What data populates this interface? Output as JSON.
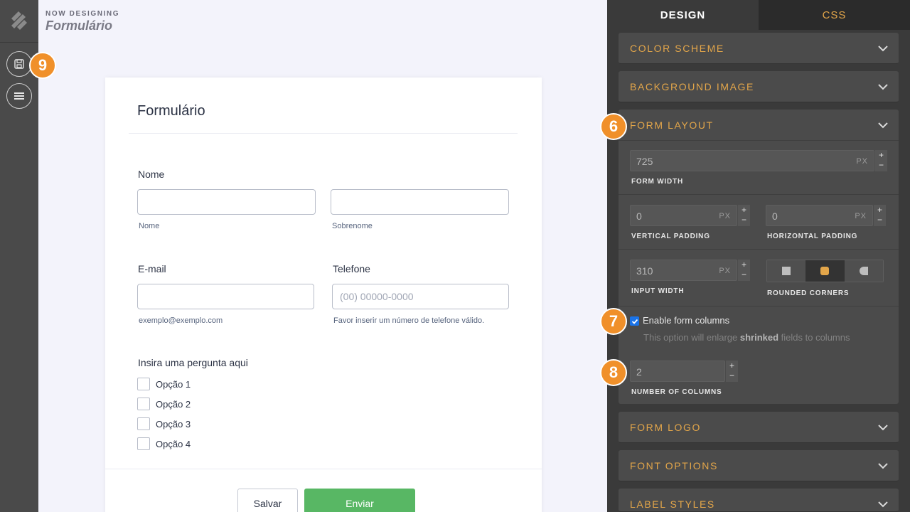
{
  "header": {
    "now_designing": "NOW DESIGNING",
    "design_name": "Formulário"
  },
  "rail": {
    "save_icon": "floppy-disk-icon",
    "menu_icon": "hamburger-menu-icon"
  },
  "badges": {
    "b9": "9",
    "b6": "6",
    "b7": "7",
    "b8": "8"
  },
  "form": {
    "title": "Formulário",
    "name_label": "Nome",
    "first_sub": "Nome",
    "last_sub": "Sobrenome",
    "email_label": "E-mail",
    "email_sub": "exemplo@exemplo.com",
    "phone_label": "Telefone",
    "phone_placeholder": "(00) 00000-0000",
    "phone_sub": "Favor inserir um número de telefone válido.",
    "question_label": "Insira uma pergunta aqui",
    "options": [
      "Opção 1",
      "Opção 2",
      "Opção 3",
      "Opção 4"
    ],
    "save_label": "Salvar",
    "send_label": "Enviar"
  },
  "panel": {
    "tabs": [
      "DESIGN",
      "CSS"
    ],
    "sections": {
      "color_scheme": "COLOR SCHEME",
      "background_image": "BACKGROUND IMAGE",
      "form_layout": "FORM LAYOUT",
      "form_logo": "FORM LOGO",
      "font_options": "FONT OPTIONS",
      "label_styles": "LABEL STYLES"
    },
    "layout": {
      "form_width": "725",
      "form_width_caption": "FORM WIDTH",
      "unit": "PX",
      "vertical_padding": "0",
      "vertical_padding_caption": "VERTICAL PADDING",
      "horizontal_padding": "0",
      "horizontal_padding_caption": "HORIZONTAL PADDING",
      "input_width": "310",
      "input_width_caption": "INPUT WIDTH",
      "rounded_corners_caption": "ROUNDED CORNERS",
      "enable_columns_label": "Enable form columns",
      "hint_prefix": "This option will enlarge ",
      "hint_bold": "shrinked",
      "hint_suffix": " fields to columns",
      "num_columns": "2",
      "num_columns_caption": "NUMBER OF COLUMNS",
      "plus": "+",
      "minus": "−"
    }
  },
  "colors": {
    "accent": "#e3a64a",
    "badge": "#f0902a",
    "send": "#58b764"
  }
}
